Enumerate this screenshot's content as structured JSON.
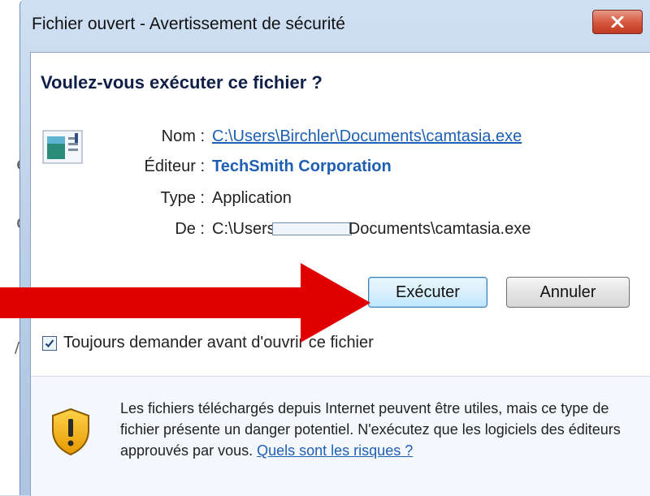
{
  "dialog": {
    "title": "Fichier ouvert - Avertissement de sécurité",
    "question": "Voulez-vous exécuter ce fichier ?"
  },
  "details": {
    "name_label": "Nom :",
    "name_value": "C:\\Users\\Birchler\\Documents\\camtasia.exe",
    "publisher_label": "Éditeur :",
    "publisher_value": "TechSmith Corporation",
    "type_label": "Type :",
    "type_value": "Application",
    "from_label": "De :",
    "from_value_prefix": "C:\\Users",
    "from_value_suffix": "Documents\\camtasia.exe"
  },
  "buttons": {
    "run_label": "Exécuter",
    "cancel_label": "Annuler"
  },
  "checkbox": {
    "label": "Toujours demander avant d'ouvrir ce fichier",
    "checked": true
  },
  "warning": {
    "text": "Les fichiers téléchargés depuis Internet peuvent être utiles, mais ce type de fichier présente un danger potentiel. N'exécutez que les logiciels des éditeurs approuvés par vous.",
    "link": "Quels sont les risques ?"
  },
  "background": {
    "glyphs": [
      "e",
      "d",
      "/i"
    ]
  },
  "icons": {
    "close": "close-icon",
    "file": "application-icon",
    "shield": "warning-shield-icon",
    "check": "checkmark-icon",
    "arrow": "red-arrow-annotation"
  },
  "colors": {
    "link": "#1d5fb3",
    "question": "#0f1f48",
    "close_button": "#c23a22",
    "arrow": "#e00000"
  }
}
